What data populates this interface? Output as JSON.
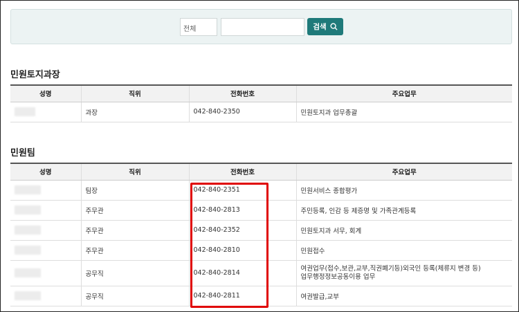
{
  "search": {
    "scope_label": "전체",
    "query_value": "",
    "button_label": "검색"
  },
  "sections": [
    {
      "title": "민원토지과장",
      "headers": [
        "성명",
        "직위",
        "전화번호",
        "주요업무"
      ],
      "rows": [
        {
          "name": "",
          "position": "과장",
          "phone": "042-840-2350",
          "duty": "민원토지과 업무총괄"
        }
      ]
    },
    {
      "title": "민원팀",
      "headers": [
        "성명",
        "직위",
        "전화번호",
        "주요업무"
      ],
      "rows": [
        {
          "name": "",
          "position": "팀장",
          "phone": "042-840-2351",
          "duty": "민원서비스 종합평가"
        },
        {
          "name": "",
          "position": "주무관",
          "phone": "042-840-2813",
          "duty": "주민등록, 인감 등 제증명 및 가족관계등록"
        },
        {
          "name": "",
          "position": "주무관",
          "phone": "042-840-2352",
          "duty": "민원토지과 서무, 회계"
        },
        {
          "name": "",
          "position": "주무관",
          "phone": "042-840-2810",
          "duty": "민원접수"
        },
        {
          "name": "",
          "position": "공무직",
          "phone": "042-840-2814",
          "duty": "여권업무(접수,보관,교부,직권폐기등)외국인 등록(체류지 변경 등)",
          "duty_line2": "업무행정정보공동이용 업무"
        },
        {
          "name": "",
          "position": "공무직",
          "phone": "042-840-2811",
          "duty": "여권발급,교부"
        }
      ]
    }
  ],
  "colors": {
    "accent": "#1f7a7a",
    "highlight": "#e00000",
    "search_bg": "#ecf3f3"
  }
}
